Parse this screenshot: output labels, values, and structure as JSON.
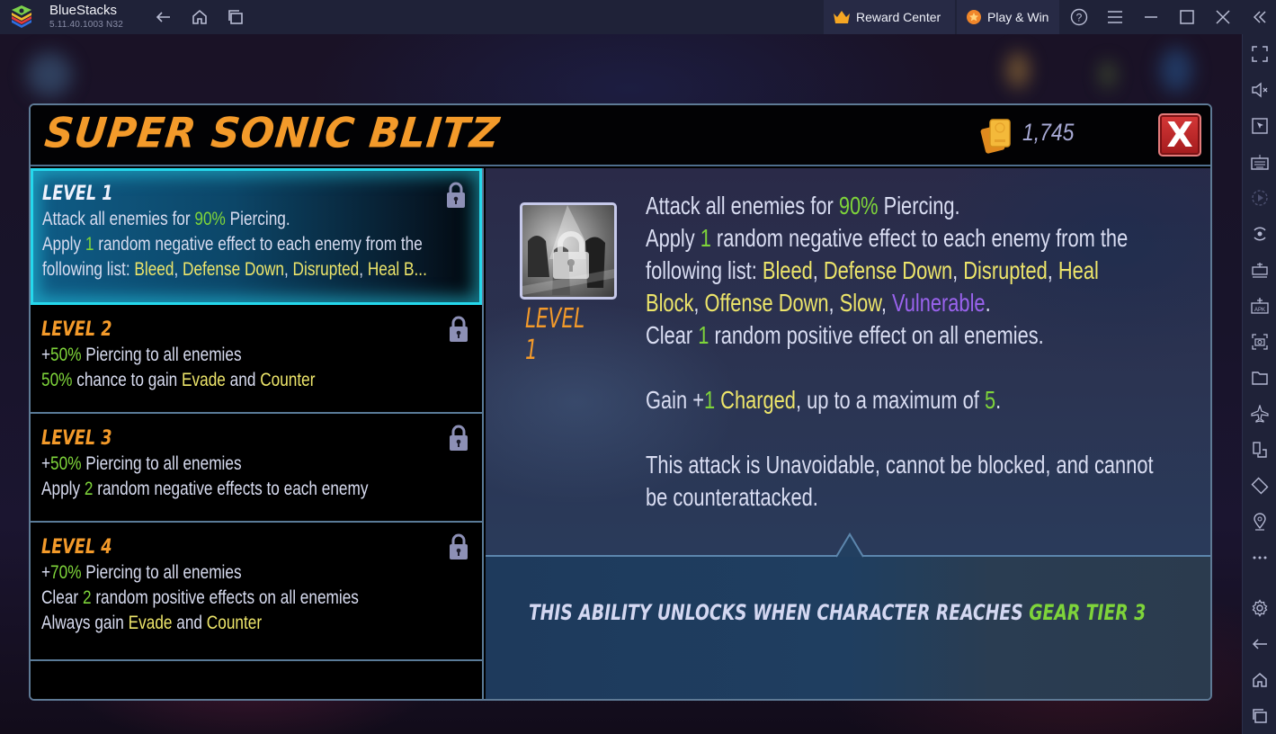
{
  "titlebar": {
    "app_name": "BlueStacks",
    "version": "5.11.40.1003  N32",
    "reward_center": "Reward Center",
    "play_win": "Play & Win"
  },
  "sidebar": {
    "icons": [
      "fullscreen-icon",
      "mute-icon",
      "pointer-icon",
      "keyboard-icon",
      "record-icon",
      "rotate-sync-icon",
      "macro-icon",
      "apk-icon",
      "screenshot-icon",
      "folder-icon",
      "airplane-icon",
      "multi-instance-icon",
      "rotate-screen-icon",
      "location-icon",
      "more-icon",
      "settings-icon",
      "back-icon",
      "home-icon",
      "recents-icon"
    ]
  },
  "modal": {
    "title": "SUPER SONIC BLITZ",
    "gold": "1,745",
    "close_label": "X"
  },
  "levels": [
    {
      "title": "LEVEL 1",
      "locked": true,
      "selected": true,
      "lines": [
        [
          {
            "t": "Attack all enemies for "
          },
          {
            "t": "90%",
            "c": "g"
          },
          {
            "t": " Piercing."
          }
        ],
        [
          {
            "t": "Apply "
          },
          {
            "t": "1",
            "c": "g"
          },
          {
            "t": " random negative effect to each enemy from the"
          }
        ],
        [
          {
            "t": "following list: "
          },
          {
            "t": "Bleed",
            "c": "y"
          },
          {
            "t": ", "
          },
          {
            "t": "Defense Down",
            "c": "y"
          },
          {
            "t": ", "
          },
          {
            "t": "Disrupted",
            "c": "y"
          },
          {
            "t": ", "
          },
          {
            "t": "Heal B...",
            "c": "y"
          }
        ]
      ]
    },
    {
      "title": "LEVEL 2",
      "locked": true,
      "selected": false,
      "lines": [
        [
          {
            "t": "+"
          },
          {
            "t": "50%",
            "c": "g"
          },
          {
            "t": " Piercing to all enemies"
          }
        ],
        [
          {
            "t": "50%",
            "c": "g"
          },
          {
            "t": " chance to gain "
          },
          {
            "t": "Evade",
            "c": "y"
          },
          {
            "t": " and "
          },
          {
            "t": "Counter",
            "c": "y"
          }
        ]
      ]
    },
    {
      "title": "LEVEL 3",
      "locked": true,
      "selected": false,
      "lines": [
        [
          {
            "t": "+"
          },
          {
            "t": "50%",
            "c": "g"
          },
          {
            "t": " Piercing to all enemies"
          }
        ],
        [
          {
            "t": "Apply "
          },
          {
            "t": "2",
            "c": "g"
          },
          {
            "t": " random negative effects to each enemy"
          }
        ]
      ]
    },
    {
      "title": "LEVEL 4",
      "locked": true,
      "selected": false,
      "lines": [
        [
          {
            "t": "+"
          },
          {
            "t": "70%",
            "c": "g"
          },
          {
            "t": " Piercing to all enemies"
          }
        ],
        [
          {
            "t": "Clear "
          },
          {
            "t": "2",
            "c": "g"
          },
          {
            "t": " random positive effects on all enemies"
          }
        ],
        [
          {
            "t": "Always gain "
          },
          {
            "t": "Evade",
            "c": "y"
          },
          {
            "t": " and "
          },
          {
            "t": "Counter",
            "c": "y"
          }
        ]
      ]
    }
  ],
  "detail": {
    "thumb_level": "LEVEL 1",
    "lines": [
      [
        {
          "t": "Attack all enemies for "
        },
        {
          "t": "90%",
          "c": "g"
        },
        {
          "t": " Piercing."
        }
      ],
      [
        {
          "t": "Apply "
        },
        {
          "t": "1",
          "c": "g"
        },
        {
          "t": " random negative effect to each enemy from the"
        }
      ],
      [
        {
          "t": "following list: "
        },
        {
          "t": "Bleed",
          "c": "y"
        },
        {
          "t": ", "
        },
        {
          "t": "Defense Down",
          "c": "y"
        },
        {
          "t": ", "
        },
        {
          "t": "Disrupted",
          "c": "y"
        },
        {
          "t": ", "
        },
        {
          "t": "Heal",
          "c": "y"
        }
      ],
      [
        {
          "t": "Block",
          "c": "y"
        },
        {
          "t": ", "
        },
        {
          "t": "Offense Down",
          "c": "y"
        },
        {
          "t": ", "
        },
        {
          "t": "Slow",
          "c": "y"
        },
        {
          "t": ", "
        },
        {
          "t": "Vulnerable",
          "c": "p"
        },
        {
          "t": "."
        }
      ],
      [
        {
          "t": "Clear "
        },
        {
          "t": "1",
          "c": "g"
        },
        {
          "t": " random positive effect on all enemies."
        }
      ],
      [],
      [
        {
          "t": "Gain +"
        },
        {
          "t": "1",
          "c": "g"
        },
        {
          "t": " "
        },
        {
          "t": "Charged",
          "c": "y"
        },
        {
          "t": ", up to a maximum of "
        },
        {
          "t": "5",
          "c": "g"
        },
        {
          "t": "."
        }
      ],
      [],
      [
        {
          "t": "This attack is Unavoidable, cannot be blocked, and cannot"
        }
      ],
      [
        {
          "t": "be counterattacked."
        }
      ]
    ],
    "unlock_prefix": "THIS ABILITY UNLOCKS WHEN CHARACTER REACHES ",
    "unlock_highlight": "GEAR TIER 3"
  },
  "colors": {
    "accent_orange": "#f39a2a",
    "green": "#7ed43a",
    "yellow": "#ede56a",
    "purple": "#9a63ee",
    "selected_border": "#25d8ec",
    "close_red": "#c62a2c"
  }
}
